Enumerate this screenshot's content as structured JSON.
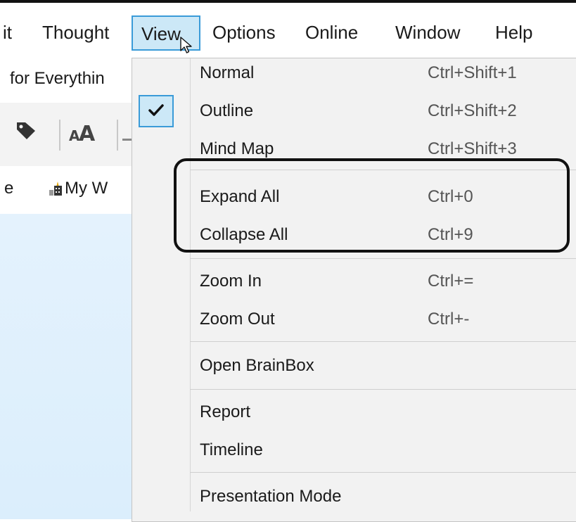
{
  "menubar": {
    "items": [
      {
        "label": "it"
      },
      {
        "label": "Thought"
      },
      {
        "label": "View"
      },
      {
        "label": "Options"
      },
      {
        "label": "Online"
      },
      {
        "label": "Window"
      },
      {
        "label": "Help"
      }
    ]
  },
  "left": {
    "title": "for Everythin",
    "toolbar_icons": [
      "tag-icon",
      "font-size-icon",
      "dash-icon"
    ],
    "tabs": {
      "partial_label": "e",
      "label": "My W",
      "icon": "house-icon"
    }
  },
  "view_menu": {
    "groups": [
      [
        {
          "label": "Normal",
          "shortcut": "Ctrl+Shift+1",
          "checked": false
        },
        {
          "label": "Outline",
          "shortcut": "Ctrl+Shift+2",
          "checked": true
        },
        {
          "label": "Mind Map",
          "shortcut": "Ctrl+Shift+3",
          "checked": false
        }
      ],
      [
        {
          "label": "Expand All",
          "shortcut": "Ctrl+0"
        },
        {
          "label": "Collapse All",
          "shortcut": "Ctrl+9"
        }
      ],
      [
        {
          "label": "Zoom In",
          "shortcut": "Ctrl+="
        },
        {
          "label": "Zoom Out",
          "shortcut": "Ctrl+-"
        }
      ],
      [
        {
          "label": "Open BrainBox",
          "shortcut": ""
        }
      ],
      [
        {
          "label": "Report",
          "shortcut": ""
        },
        {
          "label": "Timeline",
          "shortcut": ""
        }
      ],
      [
        {
          "label": "Presentation Mode",
          "shortcut": ""
        }
      ]
    ]
  },
  "colors": {
    "menu_active_bg": "#cce8f7",
    "menu_active_border": "#3a9bd8",
    "dropdown_bg": "#f2f2f2",
    "annotation_border": "#111111",
    "canvas_bg": "#e4f2fd"
  }
}
